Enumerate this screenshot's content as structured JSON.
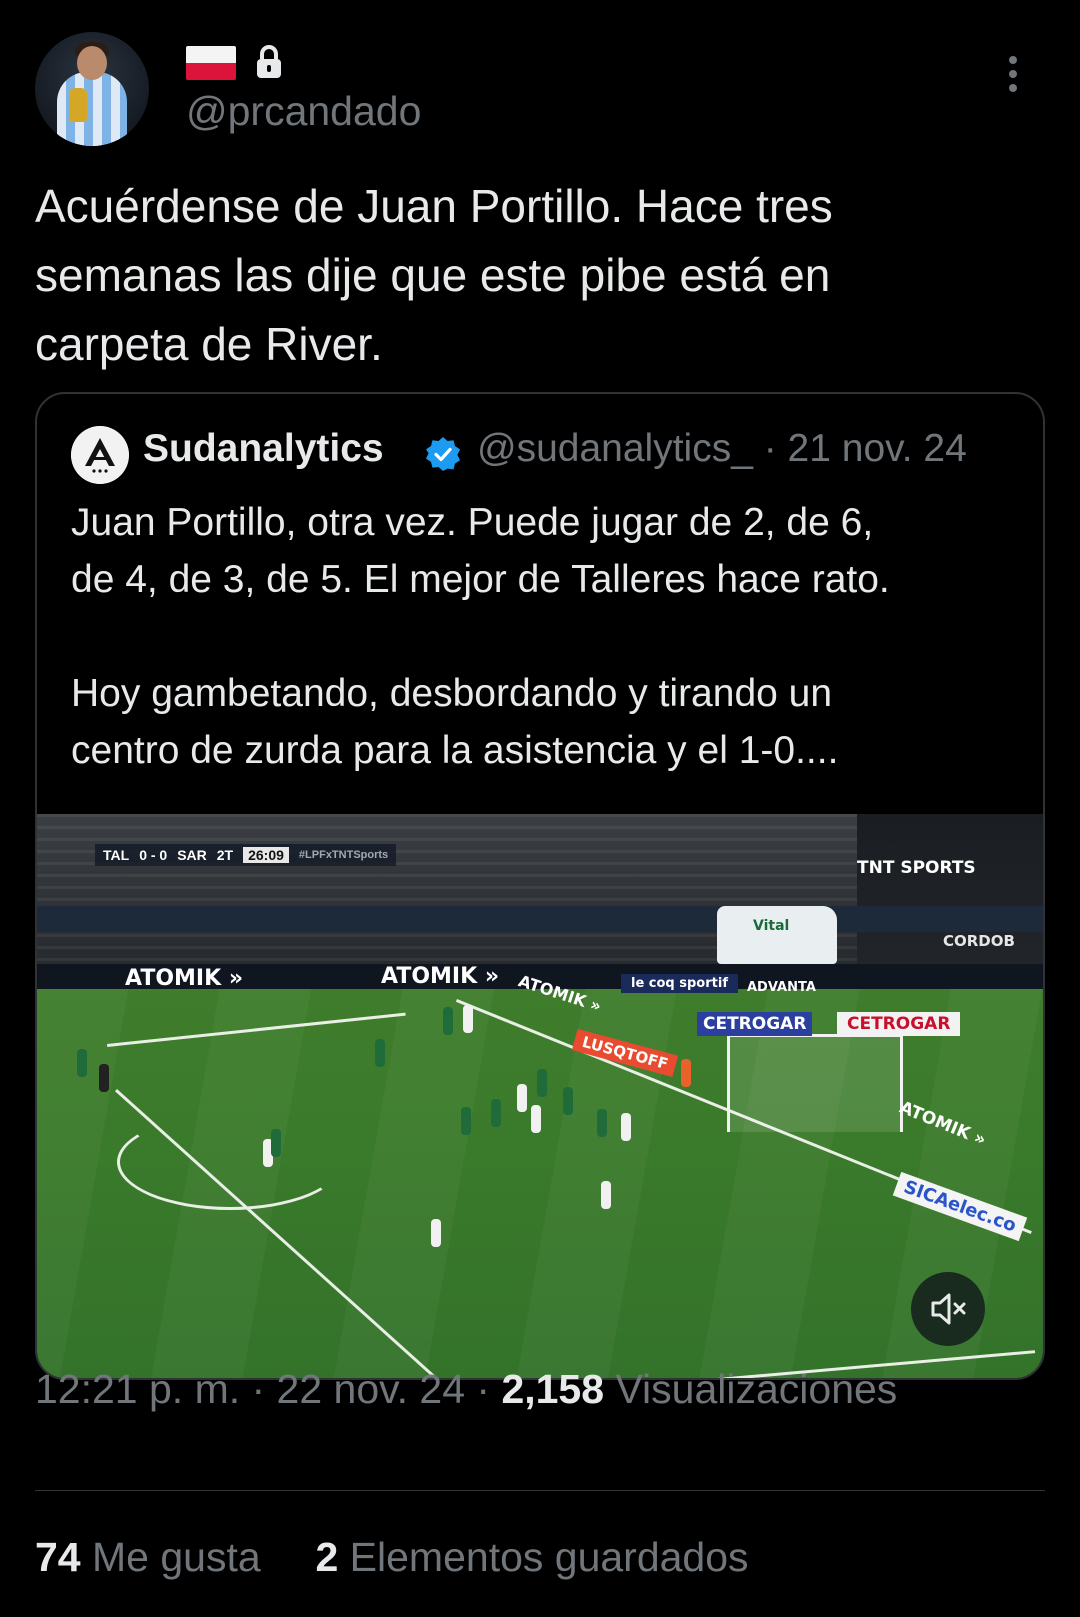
{
  "author": {
    "handle": "@prcandado",
    "flag_icon": "poland-flag-icon",
    "lock_icon": "lock-icon"
  },
  "tweet": {
    "text": "Acuérdense de Juan Portillo. Hace tres\nsemanas las dije que este pibe está en\ncarpeta de River."
  },
  "quote": {
    "name": "Sudanalytics",
    "handle_date": "@sudanalytics_ · 21 nov. 24",
    "text": "Juan Portillo, otra vez. Puede jugar de 2, de 6,\nde 4, de 3, de 5. El mejor de Talleres hace rato.\n\nHoy gambetando, desbordando y tirando un\ncentro de zurda para la asistencia y el 1-0....",
    "media": {
      "scorebug": {
        "home": "TAL",
        "score": "0 - 0",
        "away": "SAR",
        "period": "2T",
        "clock": "26:09",
        "tag": "#LPFxTNTSports"
      },
      "channel": "TNT SPORTS",
      "ads": [
        "ATOMIK »",
        "ATOMIK »",
        "ATOMIK »",
        "ATOMIK »",
        "CETROGAR",
        "CETROGAR",
        "SICAelec.co",
        "le coq sportif",
        "ADVANTA",
        "LUSQTOFF",
        "Vital",
        "CORDOB"
      ],
      "mute_icon": "muted-speaker-icon"
    }
  },
  "meta": {
    "time_date": "12:21 p. m. · 22 nov. 24 · ",
    "views_count": "2,158",
    "views_label": " Visualizaciones"
  },
  "stats": {
    "likes_count": "74",
    "likes_label": " Me gusta",
    "bookmarks_count": "2",
    "bookmarks_label": " Elementos guardados"
  },
  "colors": {
    "background": "#000000",
    "text": "#e7e9ea",
    "muted": "#71767b",
    "verified": "#1d9bf0",
    "border": "#2f3336"
  }
}
